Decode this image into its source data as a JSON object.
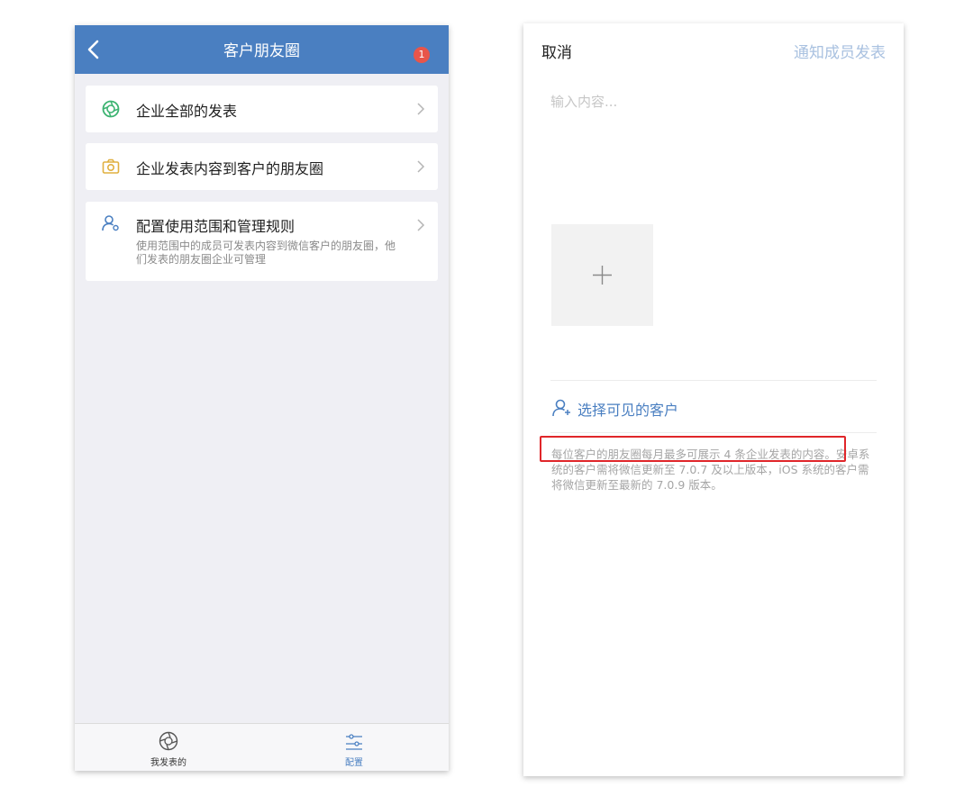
{
  "left": {
    "header": {
      "title": "客户朋友圈",
      "badge": "1"
    },
    "menu": [
      {
        "label": "企业全部的发表",
        "icon": "aperture-icon"
      },
      {
        "label": "企业发表内容到客户的朋友圈",
        "icon": "camera-icon"
      },
      {
        "label": "配置使用范围和管理规则",
        "icon": "user-settings-icon",
        "description": "使用范围中的成员可发表内容到微信客户的朋友圈，他们发表的朋友圈企业可管理"
      }
    ],
    "tabs": [
      {
        "label": "我发表的",
        "icon": "aperture-icon"
      },
      {
        "label": "配置",
        "icon": "sliders-icon"
      }
    ],
    "colors": {
      "header": "#4a7fc1",
      "accent": "#4a7fc1",
      "badge": "#e8554a"
    }
  },
  "right": {
    "cancel_label": "取消",
    "notify_label": "通知成员发表",
    "input_placeholder": "输入内容...",
    "select_label": "选择可见的客户",
    "note": "每位客户的朋友圈每月最多可展示 4 条企业发表的内容。安卓系统的客户需将微信更新至 7.0.7 及以上版本，iOS 系统的客户需将微信更新至最新的 7.0.9 版本。",
    "colors": {
      "notify": "#a9c1e0",
      "highlight": "#e0262a"
    }
  }
}
